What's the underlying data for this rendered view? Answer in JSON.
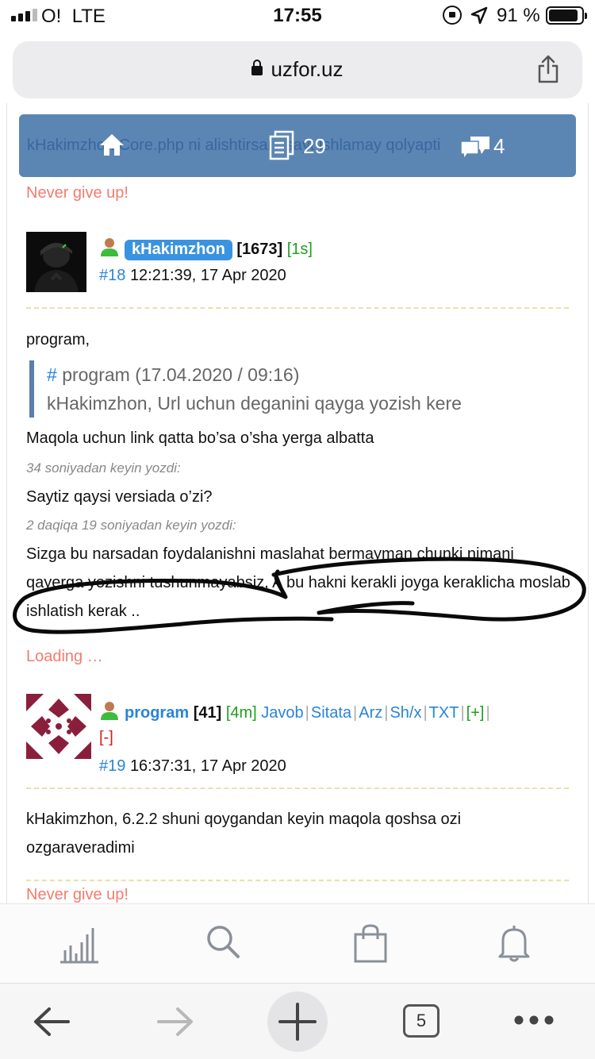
{
  "status": {
    "carrier": "O!",
    "network": "LTE",
    "time": "17:55",
    "battery_pct": "91 %"
  },
  "browser": {
    "url": "uzfor.uz"
  },
  "header": {
    "breadcrumb": "kHakimzhon  Core.php ni alishtirsam sayt ishlamay qolyapti",
    "docs_count": "29",
    "comments_count": "4"
  },
  "signature_top": "Never give up!",
  "post1": {
    "username": "kHakimzhon",
    "rating": "[1673]",
    "online": "[1s]",
    "number": "#18",
    "datetime": "12:21:39, 17 Apr 2020",
    "greeting": "program,",
    "quote_head_hash": "#",
    "quote_head": "program (17.04.2020 / 09:16)",
    "quote_body": "kHakimzhon, Url uchun deganini qayga yozish kere",
    "line1": "Maqola uchun link qatta bo’sa o’sha yerga albatta",
    "meta1": "34 soniyadan keyin yozdi:",
    "line2": "Saytiz qaysi versiada o’zi?",
    "meta2": "2 daqiqa 19 soniyadan keyin yozdi:",
    "line3": "Sizga bu narsadan foydalanishni maslahat bermayman chunki nimani qayerga yozishni tushunmayabsiz, A bu hakni kerakli joyga keraklicha moslab ishlatish kerak ..",
    "loading": "Loading …"
  },
  "post2": {
    "username": "program",
    "rating": "[41]",
    "online": "[4m]",
    "actions": {
      "reply": "Javob",
      "quote": "Sitata",
      "report": "Arz",
      "pm": "Sh/x",
      "txt": "TXT",
      "plus": "[+]",
      "minus": "[-]"
    },
    "number": "#19",
    "datetime": "16:37:31, 17 Apr 2020",
    "text": "kHakimzhon, 6.2.2 shuni qoygandan keyin maqola qoshsa ozi ozgaraveradimi"
  },
  "signature_bottom": "Never give up!",
  "bottom_nav": {
    "tabs_count": "5"
  },
  "icons": {
    "home": "home-icon",
    "docs": "documents-icon",
    "chat": "chat-icon",
    "user": "user-icon",
    "stats": "stats-icon",
    "search": "search-icon",
    "shop": "shopping-bag-icon",
    "bell": "bell-icon"
  },
  "colors": {
    "header_bg": "#5b86b4",
    "link": "#2a84d8",
    "accent_salmon": "#f27c6e",
    "online_green": "#1ea01e"
  }
}
